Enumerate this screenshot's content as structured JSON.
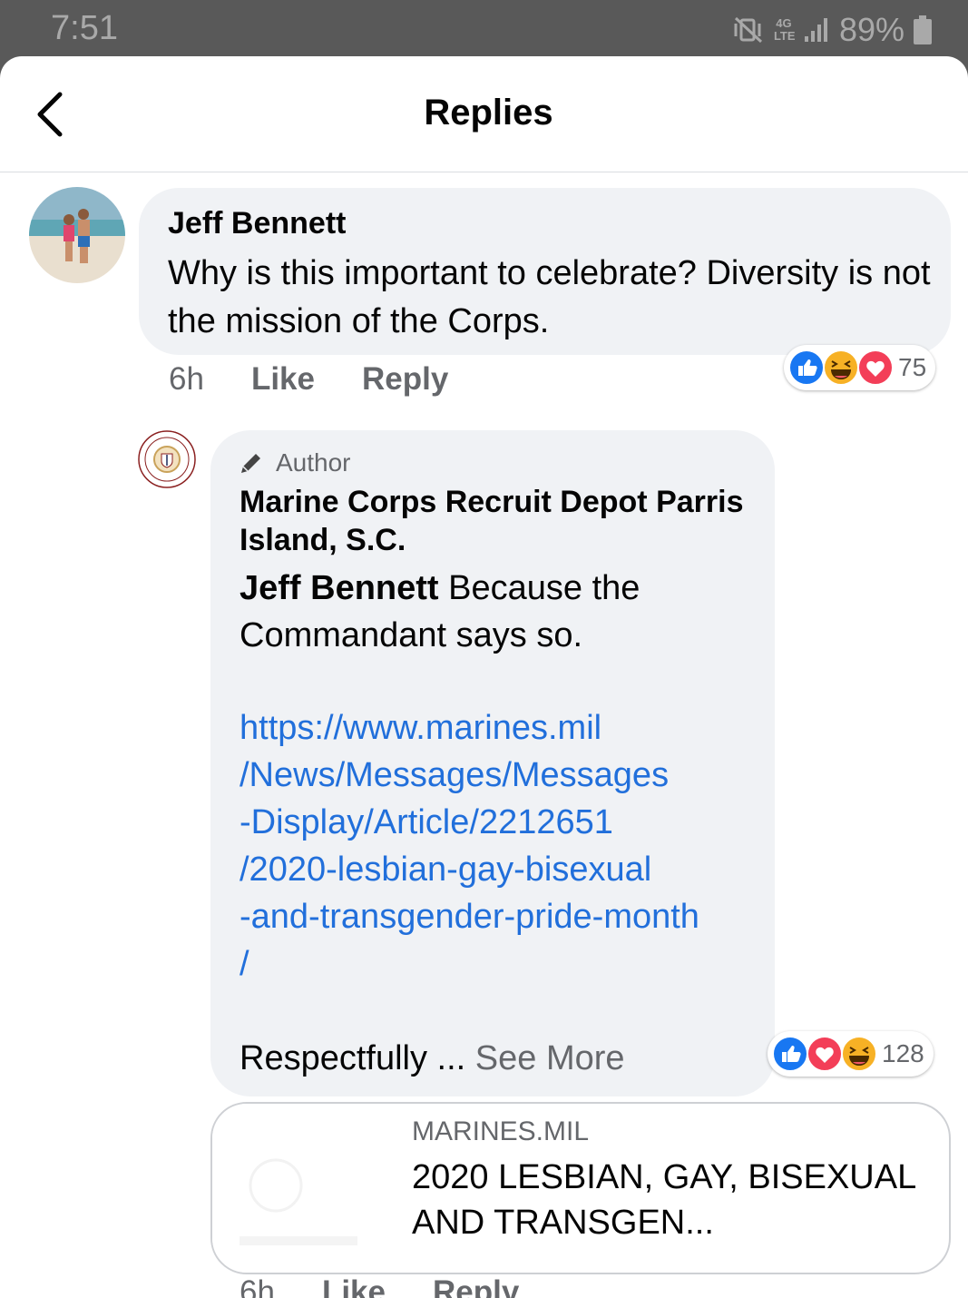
{
  "status_bar": {
    "time": "7:51",
    "network": "4G LTE",
    "battery": "89%"
  },
  "header": {
    "title": "Replies"
  },
  "comment": {
    "author": "Jeff Bennett",
    "text": "Why is this important to celebrate?  Diversity is not the mission of the Corps.",
    "time": "6h",
    "like_label": "Like",
    "reply_label": "Reply",
    "reaction_icons": [
      "like-icon",
      "haha-icon",
      "love-icon"
    ],
    "reaction_count": "75"
  },
  "reply": {
    "badge": "Author",
    "author": "Marine Corps Recruit Depot Parris Island, S.C.",
    "mention": "Jeff Bennett",
    "text": " Because the Commandant says so.",
    "link_lines": [
      "https://www.marines.mil",
      "/News/Messages/Messages",
      "-Display/Article/2212651",
      "/2020-lesbian-gay-bisexual",
      "-and-transgender-pride-month",
      "/"
    ],
    "truncated_text": "Respectfully",
    "ellipsis": " ... ",
    "see_more": "See More",
    "reaction_icons": [
      "like-icon",
      "love-icon",
      "haha-icon"
    ],
    "reaction_count": "128",
    "time": "6h",
    "like_label": "Like",
    "reply_label": "Reply"
  },
  "link_card": {
    "domain": "MARINES.MIL",
    "title": "2020 LESBIAN, GAY, BISEXUAL AND TRANSGEN..."
  },
  "colors": {
    "link": "#216fdb",
    "bubble": "#f0f2f5",
    "secondary_text": "#65676b",
    "like_blue": "#1877f2",
    "love_red": "#f33e58",
    "haha_yellow": "#f7b125"
  }
}
